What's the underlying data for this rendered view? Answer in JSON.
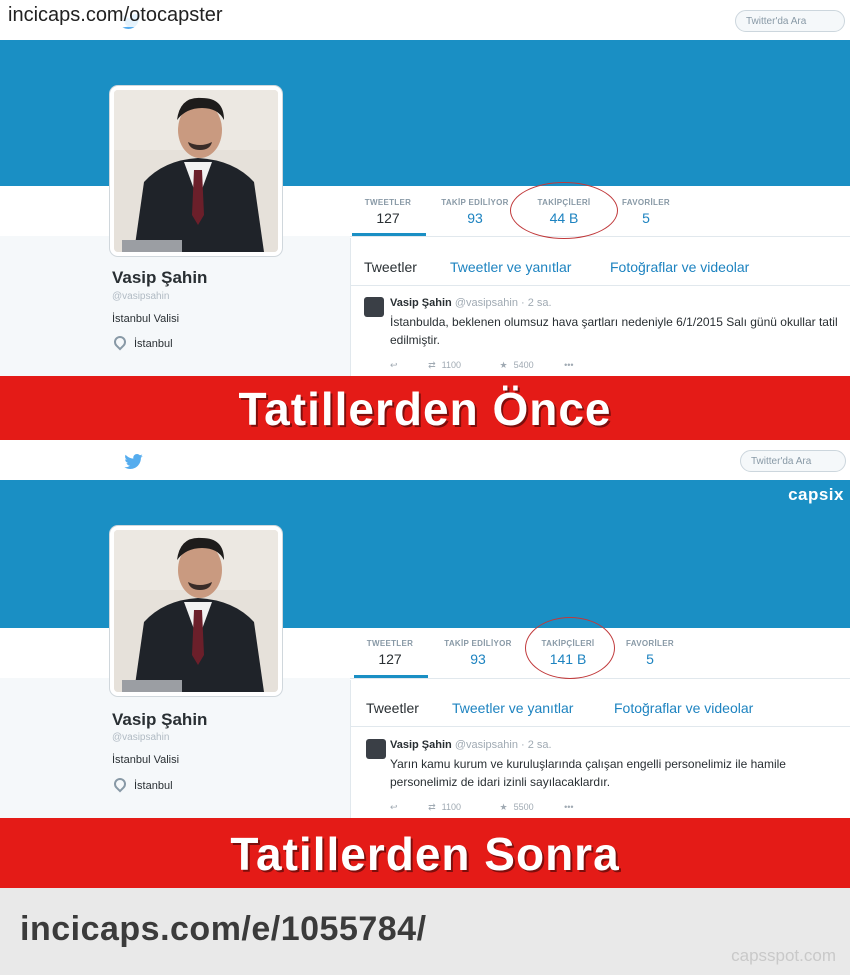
{
  "watermark_top": "incicaps.com/otocapster",
  "footer": {
    "url": "incicaps.com/e/1055784/",
    "mark": "capsspot.com"
  },
  "colors": {
    "banner": "#1a8fc4",
    "label_bar": "#e41b17",
    "link": "#1d83c0"
  },
  "icons": {
    "logo": "twitter-bird-icon",
    "location": "location-pin-icon"
  },
  "panels": [
    {
      "search_placeholder": "Twitter'da Ara",
      "profile": {
        "name": "Vasip Şahin",
        "handle": "@vasipsahin",
        "bio": "İstanbul Valisi",
        "location": "İstanbul"
      },
      "stats": [
        {
          "label": "TWEETLER",
          "value": "127"
        },
        {
          "label": "TAKİP EDİLİYOR",
          "value": "93"
        },
        {
          "label": "TAKİPÇİLERİ",
          "value": "44 B"
        },
        {
          "label": "FAVORİLER",
          "value": "5"
        }
      ],
      "tabs": [
        "Tweetler",
        "Tweetler ve yanıtlar",
        "Fotoğraflar ve videolar"
      ],
      "tweet": {
        "author": "Vasip Şahin",
        "meta": "@vasipsahin · 2 sa.",
        "text": "İstanbulda, beklenen olumsuz hava şartları nedeniyle  6/1/2015 Salı günü okullar tatil edilmiştir.",
        "retweets": "1100",
        "favorites": "5400"
      },
      "caption": "Tatillerden Önce"
    },
    {
      "search_placeholder": "Twitter'da Ara",
      "watermark": "capsix",
      "profile": {
        "name": "Vasip Şahin",
        "handle": "@vasipsahin",
        "bio": "İstanbul Valisi",
        "location": "İstanbul"
      },
      "stats": [
        {
          "label": "TWEETLER",
          "value": "127"
        },
        {
          "label": "TAKİP EDİLİYOR",
          "value": "93"
        },
        {
          "label": "TAKİPÇİLERİ",
          "value": "141 B"
        },
        {
          "label": "FAVORİLER",
          "value": "5"
        }
      ],
      "tabs": [
        "Tweetler",
        "Tweetler ve yanıtlar",
        "Fotoğraflar ve videolar"
      ],
      "tweet": {
        "author": "Vasip Şahin",
        "meta": "@vasipsahin · 2 sa.",
        "text": "Yarın kamu kurum ve kuruluşlarında çalışan engelli personelimiz ile hamile personelimiz de idari izinli sayılacaklardır.",
        "retweets": "1100",
        "favorites": "5500"
      },
      "caption": "Tatillerden Sonra"
    }
  ]
}
